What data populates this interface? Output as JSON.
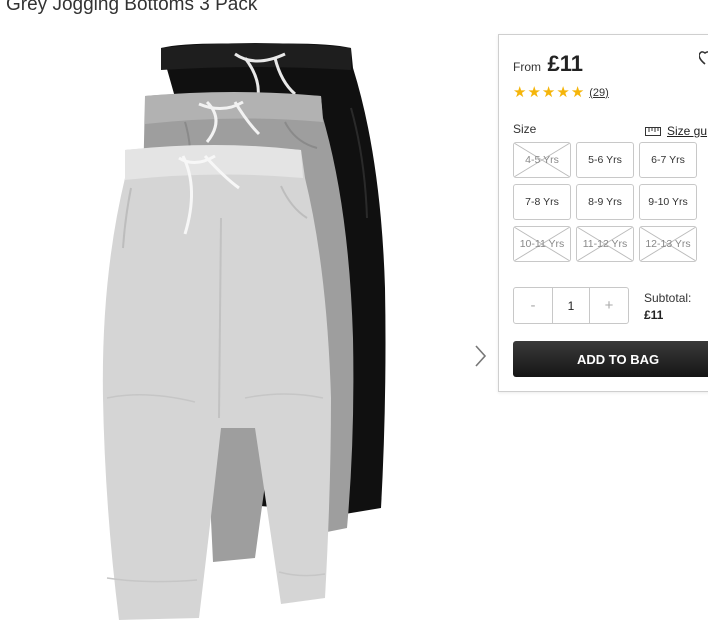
{
  "product": {
    "title": "Grey Jogging Bottoms 3 Pack",
    "image_icon": "jogging-bottoms-photo"
  },
  "gallery": {
    "next_icon": "chevron-right-icon"
  },
  "purchase": {
    "price_prefix": "From",
    "price": "£11",
    "rating": {
      "stars": 5,
      "value": 4.5,
      "review_count": "(29)",
      "star_color": "#f5b50a"
    },
    "size_label": "Size",
    "size_guide_label": "Size gu",
    "sizes": [
      {
        "label": "4-5 Yrs",
        "available": false
      },
      {
        "label": "5-6 Yrs",
        "available": true
      },
      {
        "label": "6-7 Yrs",
        "available": true
      },
      {
        "label": "7-8 Yrs",
        "available": true
      },
      {
        "label": "8-9 Yrs",
        "available": true
      },
      {
        "label": "9-10 Yrs",
        "available": true
      },
      {
        "label": "10-11 Yrs",
        "available": false
      },
      {
        "label": "11-12 Yrs",
        "available": false
      },
      {
        "label": "12-13 Yrs",
        "available": false
      }
    ],
    "quantity": {
      "minus": "-",
      "value": "1",
      "plus": "+"
    },
    "subtotal_label": "Subtotal:",
    "subtotal_value": "£11",
    "add_to_bag": "ADD TO BAG"
  }
}
